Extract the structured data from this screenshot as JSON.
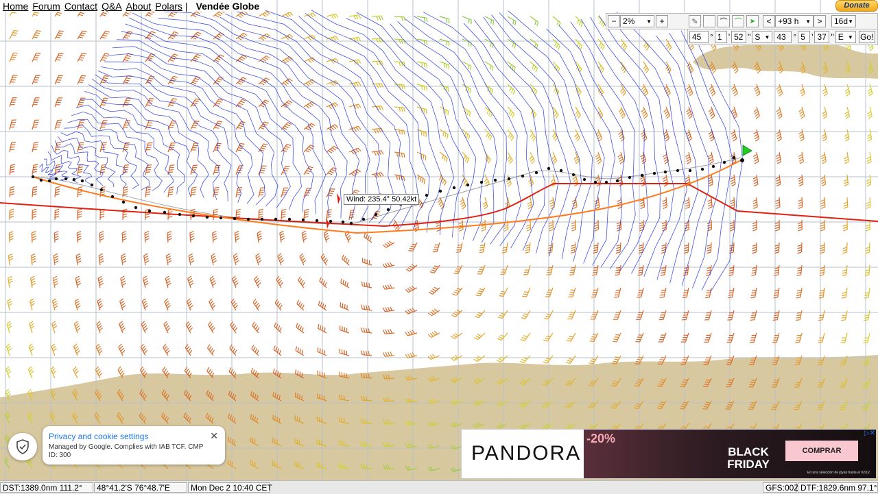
{
  "nav": {
    "items": [
      "Home",
      "Forum",
      "Contact",
      "Q&A",
      "About",
      "Polars"
    ],
    "separator": "|",
    "race": "Vendée Globe",
    "donate": "Donate"
  },
  "toolbar": {
    "zoom_minus": "−",
    "zoom_value": "2%",
    "zoom_plus": "+",
    "prev": "<",
    "time_offset": "+93 h",
    "next": ">",
    "duration": "16d"
  },
  "coords": {
    "lat_deg": "45",
    "lat_min": "1",
    "lat_sec": "52",
    "lat_hemi": "S",
    "lon_deg": "43",
    "lon_min": "5",
    "lon_sec": "37",
    "lon_hemi": "E",
    "go": "Go!",
    "deg_symbol": "°",
    "min_symbol": "'",
    "sec_symbol": "\""
  },
  "tooltip": {
    "text": "Wind: 235.4° 50.42kt"
  },
  "privacy": {
    "title": "Privacy and cookie settings",
    "text": "Managed by Google. Complies with IAB TCF. CMP ID: 300",
    "close": "✕"
  },
  "ad": {
    "brand": "PANDORA",
    "discount": "-20%",
    "headline_1": "BLACK",
    "headline_2": "FRIDAY",
    "cta": "COMPRAR",
    "fine_print": "En una selección de joyas hasta el 02/12."
  },
  "status": {
    "dst": "DST:1389.0nm 111.2°",
    "position": "48°41.2'S  76°48.7'E",
    "date": "Mon Dec  2 10:40 CET",
    "gfs": "GFS:00Z",
    "dtf": "DTF:1829.6nm  97.1°"
  },
  "colors": {
    "land": "#d8c8a0",
    "grid": "#b7bfcc",
    "isochrone": "#2233dd",
    "route_red": "#e02010",
    "route_orange": "#ff7a1a",
    "boat_flag": "#22cc22"
  }
}
